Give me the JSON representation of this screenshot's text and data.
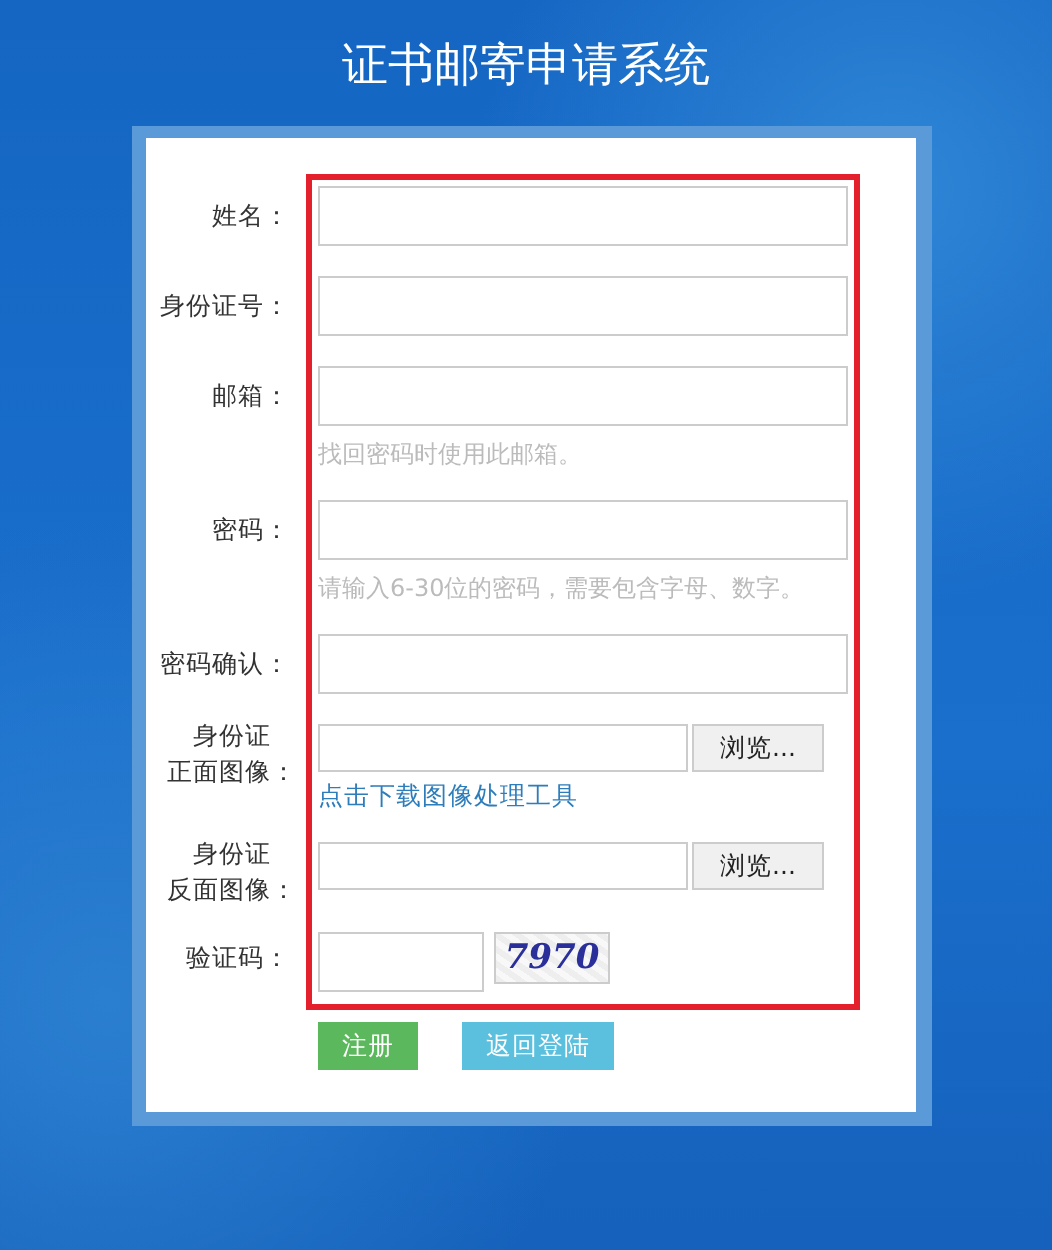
{
  "title": "证书邮寄申请系统",
  "fields": [
    {
      "kind": "text",
      "label": "姓名："
    },
    {
      "kind": "text",
      "label": "身份证号："
    },
    {
      "kind": "text",
      "label": "邮箱：",
      "hint": "找回密码时使用此邮箱。"
    },
    {
      "kind": "text",
      "label": "密码：",
      "hint": "请输入6-30位的密码，需要包含字母、数字。"
    },
    {
      "kind": "text",
      "label": "密码确认："
    },
    {
      "kind": "upload",
      "label_lines": [
        "身份证",
        "正面图像："
      ],
      "button": "浏览...",
      "link": "点击下载图像处理工具"
    },
    {
      "kind": "upload",
      "label_lines": [
        "身份证",
        "反面图像："
      ],
      "button": "浏览..."
    },
    {
      "kind": "captcha",
      "label": "验证码：",
      "code": "7970"
    }
  ],
  "buttons": [
    {
      "kind": "primary",
      "label": "注册"
    },
    {
      "kind": "secondary",
      "label": "返回登陆"
    }
  ]
}
